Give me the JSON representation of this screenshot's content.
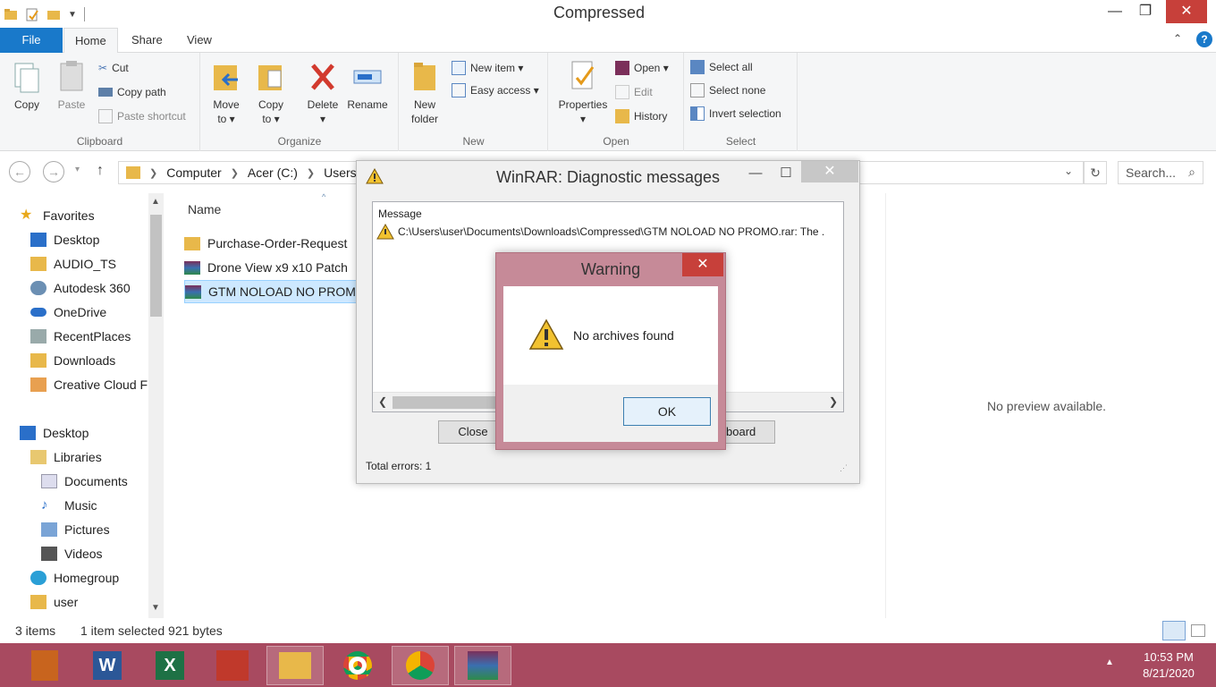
{
  "window": {
    "title": "Compressed",
    "minimize": "—",
    "maximize": "❐",
    "close": "✕"
  },
  "ribbon_tabs": {
    "file": "File",
    "home": "Home",
    "share": "Share",
    "view": "View"
  },
  "clipboard": {
    "label": "Clipboard",
    "copy": "Copy",
    "paste": "Paste",
    "cut": "Cut",
    "copy_path": "Copy path",
    "paste_shortcut": "Paste shortcut"
  },
  "organize": {
    "label": "Organize",
    "move_to_1": "Move",
    "move_to_2": "to ▾",
    "copy_to_1": "Copy",
    "copy_to_2": "to ▾",
    "delete_1": "Delete",
    "delete_2": "▾",
    "rename": "Rename"
  },
  "new": {
    "label": "New",
    "new_folder_1": "New",
    "new_folder_2": "folder",
    "new_item": "New item ▾",
    "easy_access": "Easy access ▾"
  },
  "open": {
    "label": "Open",
    "properties_1": "Properties",
    "properties_2": "▾",
    "open": "Open ▾",
    "edit": "Edit",
    "history": "History"
  },
  "select": {
    "label": "Select",
    "select_all": "Select all",
    "select_none": "Select none",
    "invert": "Invert selection"
  },
  "address": {
    "crumbs": [
      "Computer",
      "Acer (C:)",
      "Users"
    ],
    "search_placeholder": "Search..."
  },
  "navpane": {
    "items": [
      {
        "label": "Favorites"
      },
      {
        "label": "Desktop"
      },
      {
        "label": "AUDIO_TS"
      },
      {
        "label": "Autodesk 360"
      },
      {
        "label": "OneDrive"
      },
      {
        "label": "RecentPlaces"
      },
      {
        "label": "Downloads"
      },
      {
        "label": "Creative Cloud F"
      },
      {
        "label": "Desktop"
      },
      {
        "label": "Libraries"
      },
      {
        "label": "Documents"
      },
      {
        "label": "Music"
      },
      {
        "label": "Pictures"
      },
      {
        "label": "Videos"
      },
      {
        "label": "Homegroup"
      },
      {
        "label": "user"
      }
    ]
  },
  "files": {
    "column_name": "Name",
    "rows": [
      {
        "name": "Purchase-Order-Request"
      },
      {
        "name": "Drone View x9 x10 Patch"
      },
      {
        "name": "GTM NOLOAD NO PROM"
      }
    ]
  },
  "preview": {
    "text": "No preview available."
  },
  "status": {
    "items": "3 items",
    "selected": "1 item selected  921 bytes"
  },
  "winrar": {
    "title": "WinRAR: Diagnostic messages",
    "column": "Message",
    "message": "C:\\Users\\user\\Documents\\Downloads\\Compressed\\GTM NOLOAD NO PROMO.rar: The .",
    "close_btn": "Close",
    "clipboard_btn": "board",
    "total_errors": "Total errors: 1"
  },
  "warning": {
    "title": "Warning",
    "text": "No archives found",
    "ok": "OK"
  },
  "taskbar": {
    "time": "10:53 PM",
    "date": "8/21/2020"
  },
  "colors": {
    "accent": "#1979ca",
    "taskbar": "#a84a60",
    "warning_frame": "#c68a98",
    "close_red": "#c7403a"
  }
}
